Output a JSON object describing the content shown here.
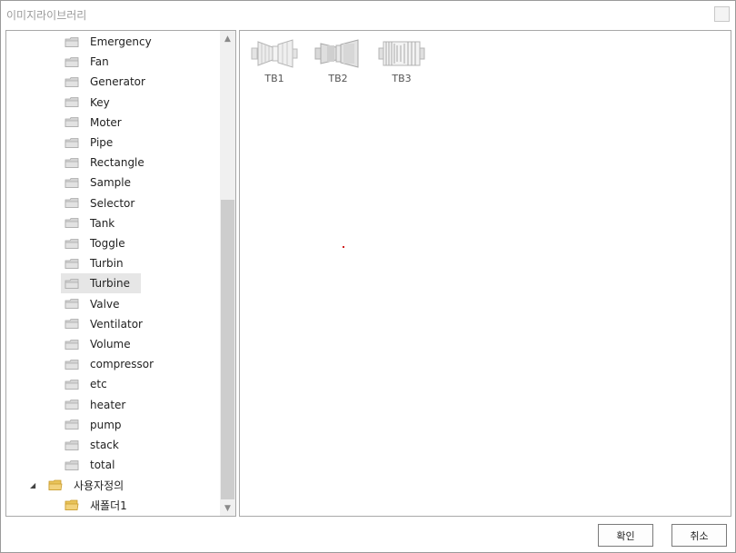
{
  "window": {
    "title": "이미지라이브러리"
  },
  "tree": {
    "items": [
      {
        "label": "Emergency",
        "selected": false
      },
      {
        "label": "Fan",
        "selected": false
      },
      {
        "label": "Generator",
        "selected": false
      },
      {
        "label": "Key",
        "selected": false
      },
      {
        "label": "Moter",
        "selected": false
      },
      {
        "label": "Pipe",
        "selected": false
      },
      {
        "label": "Rectangle",
        "selected": false
      },
      {
        "label": "Sample",
        "selected": false
      },
      {
        "label": "Selector",
        "selected": false
      },
      {
        "label": "Tank",
        "selected": false
      },
      {
        "label": "Toggle",
        "selected": false
      },
      {
        "label": "Turbin",
        "selected": false
      },
      {
        "label": "Turbine",
        "selected": true
      },
      {
        "label": "Valve",
        "selected": false
      },
      {
        "label": "Ventilator",
        "selected": false
      },
      {
        "label": "Volume",
        "selected": false
      },
      {
        "label": "compressor",
        "selected": false
      },
      {
        "label": "etc",
        "selected": false
      },
      {
        "label": "heater",
        "selected": false
      },
      {
        "label": "pump",
        "selected": false
      },
      {
        "label": "stack",
        "selected": false
      },
      {
        "label": "total",
        "selected": false
      }
    ],
    "custom_group": {
      "label": "사용자정의",
      "expanded": true,
      "icon": "open-folder-icon"
    },
    "custom_items": [
      {
        "label": "새폴더1"
      }
    ]
  },
  "images": [
    {
      "label": "TB1"
    },
    {
      "label": "TB2"
    },
    {
      "label": "TB3"
    }
  ],
  "buttons": {
    "ok": "확인",
    "cancel": "취소"
  },
  "colors": {
    "folder_gray": "#d4d4d4",
    "folder_yellow": "#e8c35a",
    "selection": "#e6e6e6"
  }
}
